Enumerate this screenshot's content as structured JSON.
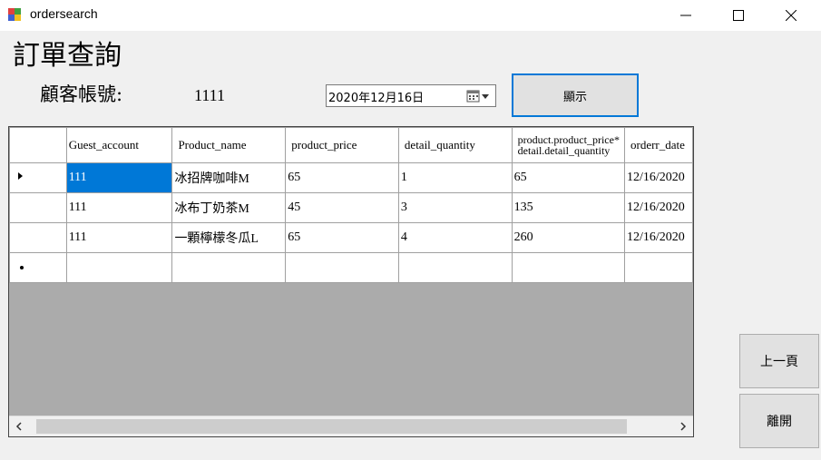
{
  "window": {
    "title": "ordersearch"
  },
  "header": {
    "page_title": "訂單查詢",
    "account_label": "顧客帳號:",
    "account_value": "1111",
    "date_value": "2020年12月16日",
    "show_button": "顯示"
  },
  "grid": {
    "columns": [
      "Guest_account",
      "Product_name",
      "product_price",
      "detail_quantity",
      "product.product_price* detail.detail_quantity",
      "orderr_date"
    ],
    "rows": [
      [
        "111",
        "冰招牌咖啡M",
        "65",
        "1",
        "65",
        "12/16/2020"
      ],
      [
        "111",
        "冰布丁奶茶M",
        "45",
        "3",
        "135",
        "12/16/2020"
      ],
      [
        "111",
        "一顆檸檬冬瓜L",
        "65",
        "4",
        "260",
        "12/16/2020"
      ]
    ],
    "selected_row": 0
  },
  "buttons": {
    "prev": "上一頁",
    "leave": "離開"
  },
  "colors": {
    "accent": "#0078d7",
    "window_bg": "#f0f0f0",
    "grid_bg": "#ababab"
  }
}
